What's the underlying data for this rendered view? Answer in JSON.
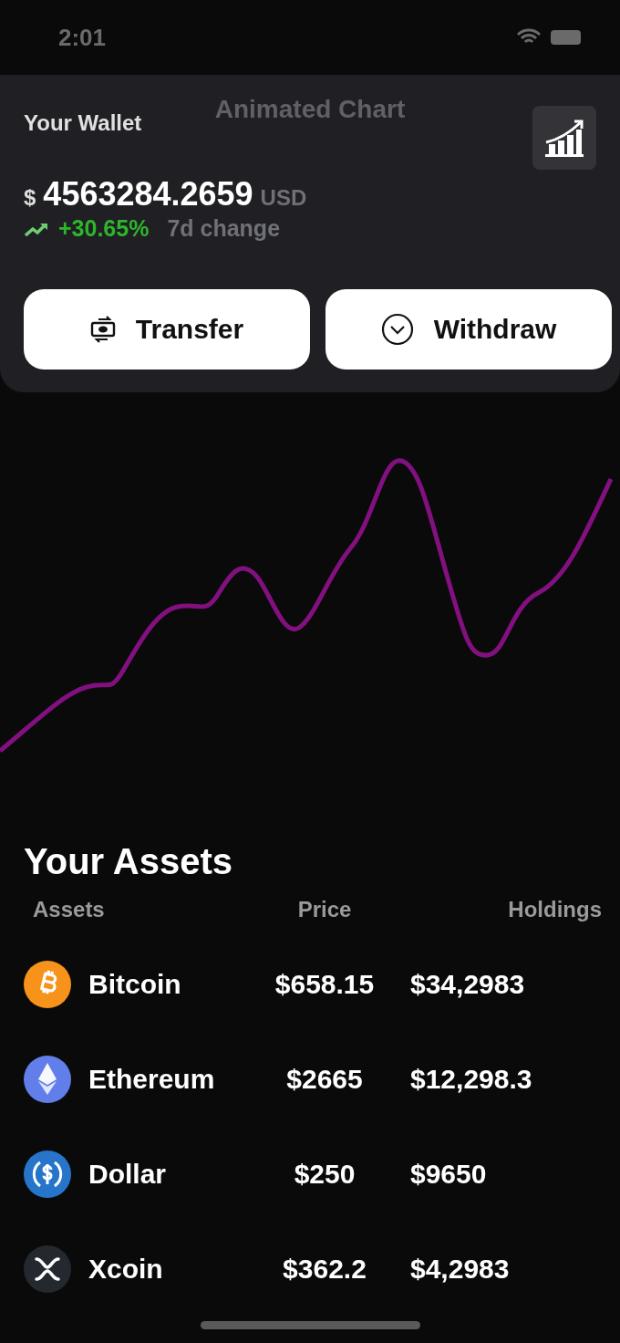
{
  "status_bar": {
    "time": "2:01"
  },
  "header": {
    "title": "Animated Chart"
  },
  "wallet": {
    "title": "Your Wallet",
    "currency_symbol": "$",
    "balance": "4563284.2659",
    "currency": "USD",
    "change": "+30.65%",
    "change_label": "7d change"
  },
  "actions": [
    {
      "kind": "transfer",
      "label": "Transfer"
    },
    {
      "kind": "withdraw",
      "label": "Withdraw"
    }
  ],
  "assets": {
    "title": "Your Assets",
    "columns": [
      "Assets",
      "Price",
      "Holdings"
    ],
    "rows": [
      {
        "kind": "bitcoin",
        "color": "#f7931a",
        "name": "Bitcoin",
        "price": "$658.15",
        "holdings": "$34,2983"
      },
      {
        "kind": "ethereum",
        "color": "#627eea",
        "name": "Ethereum",
        "price": "$2665",
        "holdings": "$12,298.3"
      },
      {
        "kind": "dollar",
        "color": "#2775ca",
        "name": "Dollar",
        "price": "$250",
        "holdings": "$9650"
      },
      {
        "kind": "xcoin",
        "color": "#23292f",
        "name": "Xcoin",
        "price": "$362.2",
        "holdings": "$4,2983"
      }
    ]
  }
}
